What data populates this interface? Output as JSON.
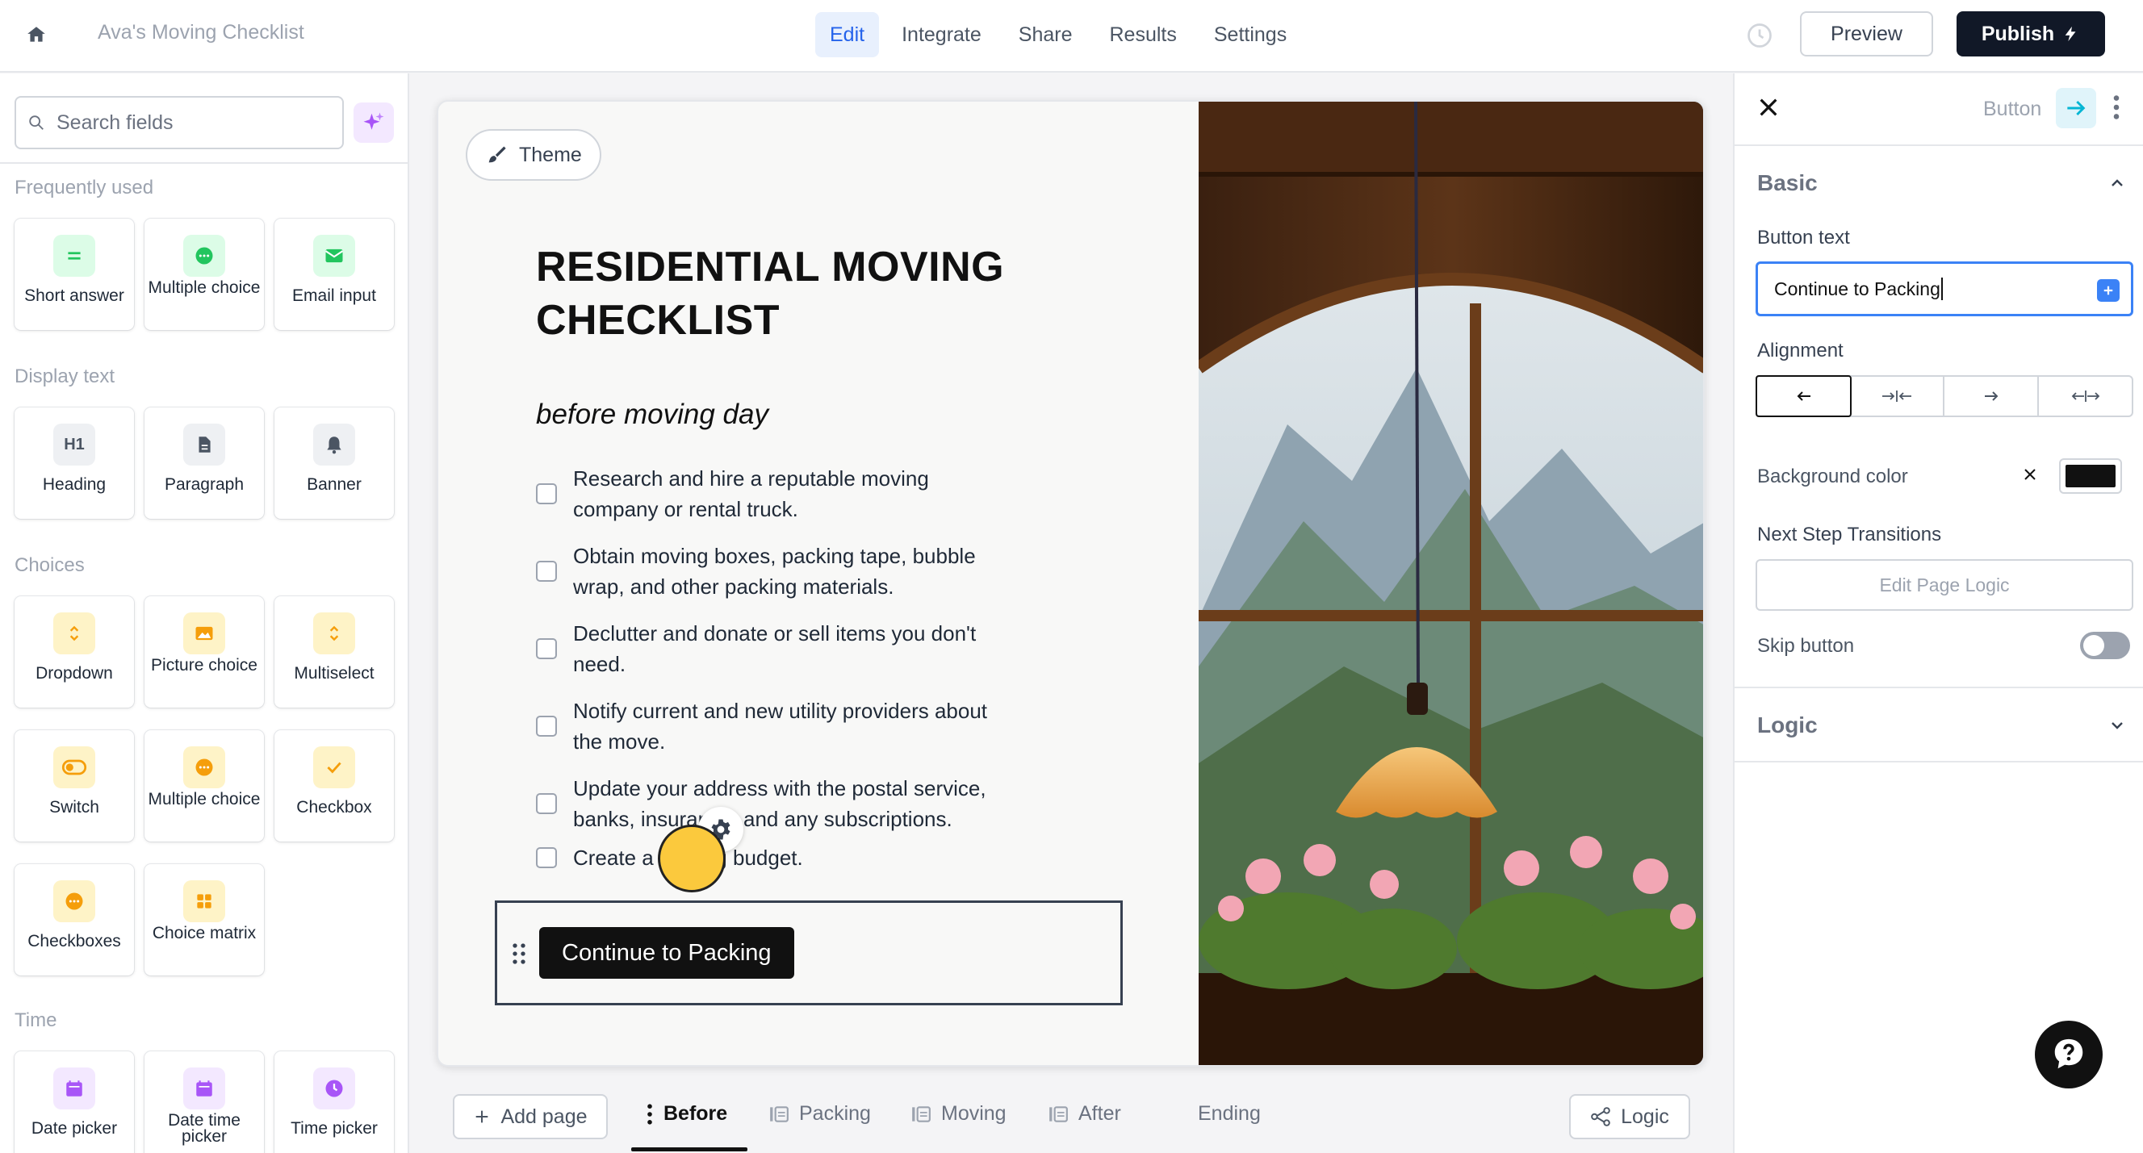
{
  "app": {
    "title": "Ava's Moving Checklist",
    "nav": [
      {
        "label": "Edit",
        "active": true
      },
      {
        "label": "Integrate",
        "active": false
      },
      {
        "label": "Share",
        "active": false
      },
      {
        "label": "Results",
        "active": false
      },
      {
        "label": "Settings",
        "active": false
      }
    ],
    "preview_label": "Preview",
    "publish_label": "Publish"
  },
  "sidebar": {
    "search_placeholder": "Search fields",
    "sections": [
      {
        "label": "Frequently used",
        "items": [
          {
            "label": "Short answer",
            "icon": "short-answer-icon"
          },
          {
            "label": "Multiple choice",
            "icon": "multiple-choice-icon"
          },
          {
            "label": "Email input",
            "icon": "email-icon"
          }
        ]
      },
      {
        "label": "Display text",
        "items": [
          {
            "label": "Heading",
            "icon": "heading-icon"
          },
          {
            "label": "Paragraph",
            "icon": "paragraph-icon"
          },
          {
            "label": "Banner",
            "icon": "bell-icon"
          }
        ]
      },
      {
        "label": "Choices",
        "items": [
          {
            "label": "Dropdown",
            "icon": "dropdown-icon"
          },
          {
            "label": "Picture choice",
            "icon": "picture-icon"
          },
          {
            "label": "Multiselect",
            "icon": "multiselect-icon"
          },
          {
            "label": "Switch",
            "icon": "switch-icon"
          },
          {
            "label": "Multiple choice",
            "icon": "multiple-choice-icon"
          },
          {
            "label": "Checkbox",
            "icon": "checkbox-icon"
          },
          {
            "label": "Checkboxes",
            "icon": "checkboxes-icon"
          },
          {
            "label": "Choice matrix",
            "icon": "grid-icon"
          }
        ]
      },
      {
        "label": "Time",
        "items": [
          {
            "label": "Date picker",
            "icon": "calendar-icon"
          },
          {
            "label": "Date time picker",
            "icon": "calendar-icon"
          },
          {
            "label": "Time picker",
            "icon": "clock-icon"
          }
        ]
      }
    ]
  },
  "canvas": {
    "theme_label": "Theme",
    "title": "RESIDENTIAL MOVING CHECKLIST",
    "subtitle": "before moving day",
    "tasks": [
      "Research and hire a reputable moving company or rental truck.",
      "Obtain moving boxes, packing tape, bubble wrap, and other packing materials.",
      "Declutter and donate or sell items you don't need.",
      "Notify current and new utility providers about the move.",
      "Update your address with the postal service, banks, insurance, and any subscriptions.",
      "Create a moving budget."
    ],
    "button_label": "Continue to Packing"
  },
  "pages": {
    "add_label": "Add page",
    "tabs": [
      {
        "label": "Before",
        "active": true
      },
      {
        "label": "Packing",
        "active": false
      },
      {
        "label": "Moving",
        "active": false
      },
      {
        "label": "After",
        "active": false
      },
      {
        "label": "Ending",
        "active": false
      }
    ],
    "logic_label": "Logic"
  },
  "panel": {
    "element_type": "Button",
    "basic_title": "Basic",
    "button_text_label": "Button text",
    "button_text_value": "Continue to Packing",
    "alignment_label": "Alignment",
    "background_label": "Background color",
    "background_color": "#111111",
    "transitions_label": "Next Step Transitions",
    "edit_logic_label": "Edit Page Logic",
    "skip_label": "Skip button",
    "skip_enabled": false,
    "logic_title": "Logic"
  },
  "colors": {
    "accent": "#2563eb",
    "field_green": "#22c55e",
    "field_orange": "#f59e0b",
    "field_purple": "#a855f7",
    "cursor": "#fbc93d"
  }
}
